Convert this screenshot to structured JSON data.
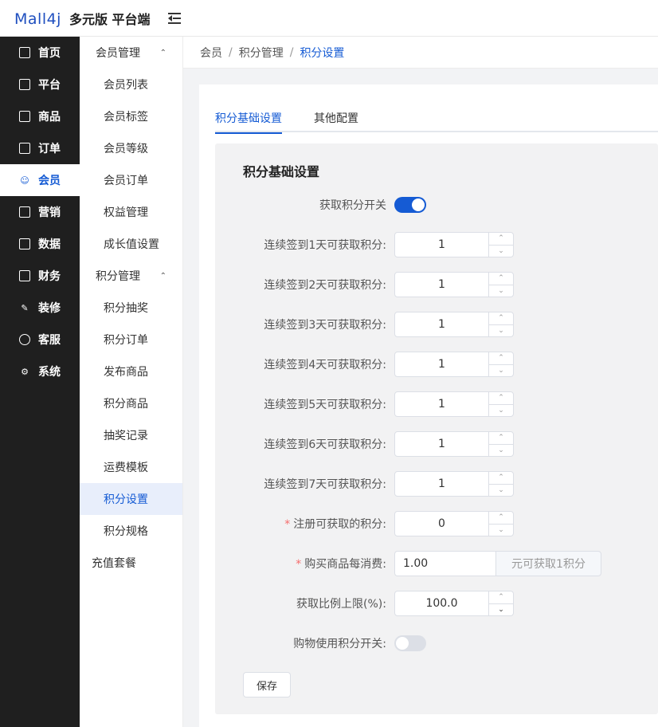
{
  "header": {
    "logo": "Mall4j",
    "title": "多元版 平台端"
  },
  "nav_main": [
    {
      "label": "首页",
      "icon": "dashboard-icon",
      "active": false
    },
    {
      "label": "平台",
      "icon": "platform-icon",
      "active": false
    },
    {
      "label": "商品",
      "icon": "product-icon",
      "active": false
    },
    {
      "label": "订单",
      "icon": "order-icon",
      "active": false
    },
    {
      "label": "会员",
      "icon": "member-icon",
      "active": true
    },
    {
      "label": "营销",
      "icon": "gift-icon",
      "active": false
    },
    {
      "label": "数据",
      "icon": "chart-icon",
      "active": false
    },
    {
      "label": "财务",
      "icon": "finance-icon",
      "active": false
    },
    {
      "label": "装修",
      "icon": "decorate-icon",
      "active": false
    },
    {
      "label": "客服",
      "icon": "chat-icon",
      "active": false
    },
    {
      "label": "系统",
      "icon": "gear-icon",
      "active": false
    }
  ],
  "nav_sub": {
    "group1": "会员管理",
    "group1_items": [
      "会员列表",
      "会员标签",
      "会员等级",
      "会员订单",
      "权益管理",
      "成长值设置"
    ],
    "group2": "积分管理",
    "group2_items": [
      "积分抽奖",
      "积分订单",
      "发布商品",
      "积分商品",
      "抽奖记录",
      "运费模板",
      "积分设置",
      "积分规格"
    ],
    "top_item": "充值套餐"
  },
  "breadcrumb": [
    "会员",
    "积分管理",
    "积分设置"
  ],
  "tabs": [
    "积分基础设置",
    "其他配置"
  ],
  "form": {
    "title": "积分基础设置",
    "switch_label": "获取积分开关",
    "sign_rows": [
      {
        "label": "连续签到1天可获取积分:",
        "value": "1"
      },
      {
        "label": "连续签到2天可获取积分:",
        "value": "1"
      },
      {
        "label": "连续签到3天可获取积分:",
        "value": "1"
      },
      {
        "label": "连续签到4天可获取积分:",
        "value": "1"
      },
      {
        "label": "连续签到5天可获取积分:",
        "value": "1"
      },
      {
        "label": "连续签到6天可获取积分:",
        "value": "1"
      },
      {
        "label": "连续签到7天可获取积分:",
        "value": "1"
      }
    ],
    "register_label": "注册可获取的积分:",
    "register_value": "0",
    "purchase_label": "购买商品每消费:",
    "purchase_value": "1.00",
    "purchase_append": "元可获取1积分",
    "ratio_label": "获取比例上限(%):",
    "ratio_value": "100.0",
    "use_switch_label": "购物使用积分开关:",
    "save": "保存"
  },
  "colors": {
    "accent": "#155bd4",
    "sidebar": "#1f1f1f",
    "required": "#f56c6c"
  }
}
